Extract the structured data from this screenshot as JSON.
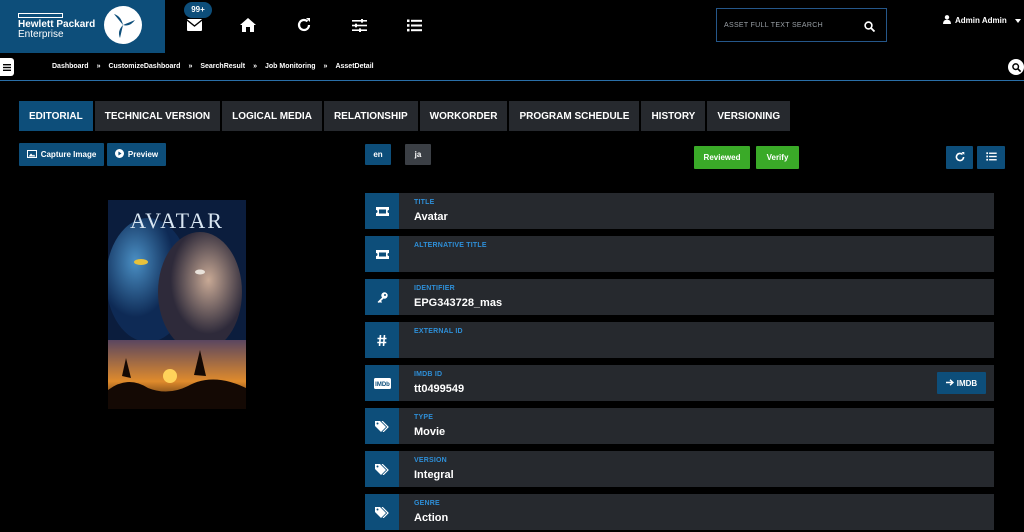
{
  "logo": {
    "line1": "Hewlett Packard",
    "line2": "Enterprise"
  },
  "header": {
    "badge": "99+",
    "search_placeholder": "ASSET FULL TEXT SEARCH",
    "user": "Admin Admin"
  },
  "breadcrumb": [
    "Dashboard",
    "CustomizeDashboard",
    "SearchResult",
    "Job Monitoring",
    "AssetDetail"
  ],
  "breadcrumb_sep": "»",
  "tabs": [
    "EDITORIAL",
    "TECHNICAL VERSION",
    "LOGICAL MEDIA",
    "RELATIONSHIP",
    "WORKORDER",
    "PROGRAM SCHEDULE",
    "HISTORY",
    "VERSIONING"
  ],
  "actions": {
    "capture": "Capture Image",
    "preview": "Preview",
    "lang_en": "en",
    "lang_ja": "ja",
    "reviewed": "Reviewed",
    "verify": "Verify"
  },
  "poster": {
    "title": "AVATAR"
  },
  "fields": [
    {
      "label": "TITLE",
      "value": "Avatar",
      "icon": "ticket-icon"
    },
    {
      "label": "ALTERNATIVE TITLE",
      "value": "",
      "icon": "ticket-icon"
    },
    {
      "label": "IDENTIFIER",
      "value": "EPG343728_mas",
      "icon": "key-icon"
    },
    {
      "label": "EXTERNAL ID",
      "value": "",
      "icon": "hash-icon"
    },
    {
      "label": "IMDB ID",
      "value": "tt0499549",
      "icon": "imdb-icon"
    },
    {
      "label": "TYPE",
      "value": "Movie",
      "icon": "tags-icon"
    },
    {
      "label": "VERSION",
      "value": "Integral",
      "icon": "tags-icon"
    },
    {
      "label": "GENRE",
      "value": "Action",
      "icon": "tags-icon"
    }
  ],
  "imdb_button": "IMDB",
  "imdb_icon_text": "IMDb",
  "colors": {
    "primary": "#0d4e7a",
    "panel": "#26292e",
    "green": "#3aaa28",
    "label": "#2e8fd8"
  }
}
